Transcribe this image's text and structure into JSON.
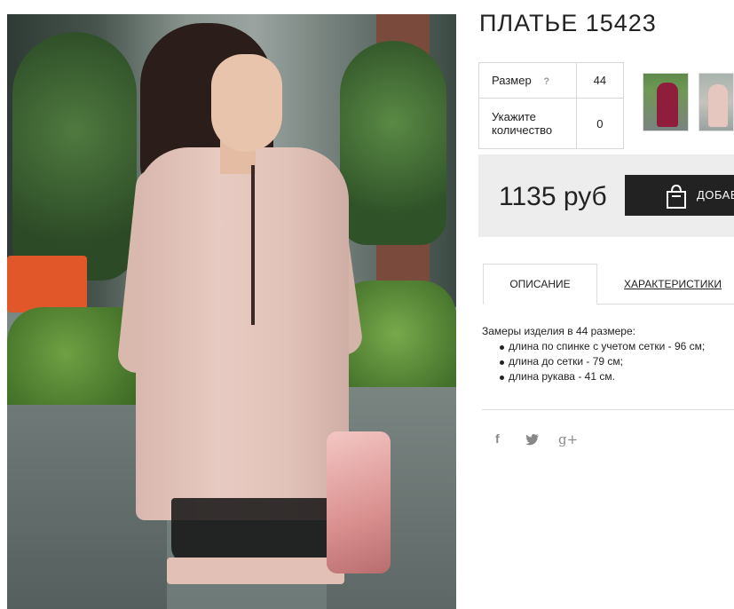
{
  "product": {
    "title": "ПЛАТЬЕ 15423",
    "image_alt": "product-photo-woman-in-pink-dress"
  },
  "params": {
    "size_label": "Размер",
    "size_help": "?",
    "size_value": "44",
    "qty_label": "Укажите количество",
    "qty_value": "0"
  },
  "price": {
    "value": "1135 руб",
    "buy_label": "ДОБАВ"
  },
  "tabs": [
    {
      "label": "ОПИСАНИЕ",
      "active": true
    },
    {
      "label": "ХАРАКТЕРИСТИКИ",
      "active": false
    }
  ],
  "description": {
    "intro": "Замеры изделия в 44 размере:",
    "items": [
      "длина по спинке с учетом сетки - 96 см;",
      "длина до сетки - 79 см;",
      "длина рукава - 41 см."
    ]
  },
  "social": {
    "facebook": "f",
    "google_plus": "g+"
  },
  "colors": {
    "buy_button_bg": "#222222",
    "price_box_bg": "#ededed",
    "border": "#d8d8d8"
  },
  "icons": [
    "bag-icon",
    "facebook-icon",
    "twitter-icon",
    "google-plus-icon",
    "help-icon"
  ]
}
